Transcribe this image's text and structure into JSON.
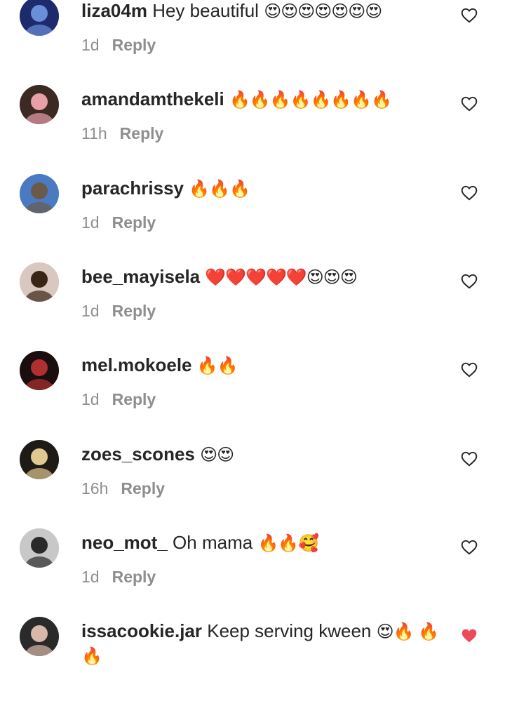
{
  "comments": [
    {
      "username": "liza04m",
      "text": "Hey beautiful",
      "emojis": "😍😍😍😍😍😍😍",
      "time": "1d",
      "reply_label": "Reply",
      "heart": "heart-outline-icon",
      "heart_color": "#262626",
      "avatar_colors": [
        "#1e2a6e",
        "#6a8fd8"
      ]
    },
    {
      "username": "amandamthekeli",
      "text": "",
      "emojis": "🔥🔥🔥🔥🔥🔥🔥🔥",
      "time": "11h",
      "reply_label": "Reply",
      "heart": "heart-outline-icon",
      "heart_color": "#262626",
      "avatar_colors": [
        "#3a2a22",
        "#e8a0a8"
      ]
    },
    {
      "username": "parachrissy",
      "text": "",
      "emojis": "🔥🔥🔥",
      "time": "1d",
      "reply_label": "Reply",
      "heart": "heart-outline-icon",
      "heart_color": "#262626",
      "avatar_colors": [
        "#4a7bc2",
        "#6b5a48"
      ]
    },
    {
      "username": "bee_mayisela",
      "text": "",
      "emojis": "❤️❤️❤️❤️❤️😍😍😍",
      "time": "1d",
      "reply_label": "Reply",
      "heart": "heart-outline-icon",
      "heart_color": "#262626",
      "avatar_colors": [
        "#d8c8c0",
        "#3a2416"
      ]
    },
    {
      "username": "mel.mokoele",
      "text": "",
      "emojis": "🔥🔥",
      "time": "1d",
      "reply_label": "Reply",
      "heart": "heart-outline-icon",
      "heart_color": "#262626",
      "avatar_colors": [
        "#1a0e0e",
        "#b03030"
      ]
    },
    {
      "username": "zoes_scones",
      "text": "",
      "emojis": "😍😍",
      "time": "16h",
      "reply_label": "Reply",
      "heart": "heart-outline-icon",
      "heart_color": "#262626",
      "avatar_colors": [
        "#1e1a16",
        "#e0c890"
      ]
    },
    {
      "username": "neo_mot_",
      "text": "Oh mama",
      "emojis": "🔥🔥🥰",
      "time": "1d",
      "reply_label": "Reply",
      "heart": "heart-outline-icon",
      "heart_color": "#262626",
      "avatar_colors": [
        "#c8c8c8",
        "#2a2a2a"
      ]
    },
    {
      "username": "issacookie.jar",
      "text": "Keep serving kween",
      "emojis": "😍🔥 🔥🔥",
      "time": "",
      "reply_label": "",
      "heart": "heart-filled-icon",
      "heart_color": "#ed4956",
      "avatar_colors": [
        "#2a2a2a",
        "#d8b8a8"
      ]
    }
  ]
}
